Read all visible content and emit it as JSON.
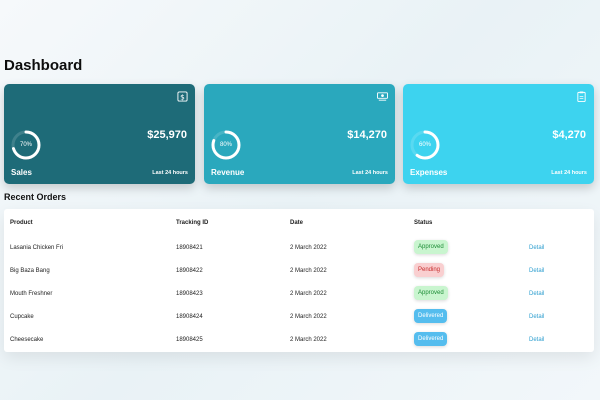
{
  "page": {
    "title": "Dashboard"
  },
  "cards": [
    {
      "label": "Sales",
      "amount": "$25,970",
      "percent_text": "70%",
      "percent": 0.7,
      "period": "Last 24 hours",
      "icon": "dollar-icon",
      "color": "#1e6b78"
    },
    {
      "label": "Revenue",
      "amount": "$14,270",
      "percent_text": "80%",
      "percent": 0.8,
      "period": "Last 24 hours",
      "icon": "money-icon",
      "color": "#2aa8bd"
    },
    {
      "label": "Expenses",
      "amount": "$4,270",
      "percent_text": "60%",
      "percent": 0.6,
      "period": "Last 24 hours",
      "icon": "clipboard-icon",
      "color": "#3dd3ef"
    }
  ],
  "orders": {
    "title": "Recent Orders",
    "headers": {
      "product": "Product",
      "tracking": "Tracking ID",
      "date": "Date",
      "status": "Status"
    },
    "rows": [
      {
        "product": "Lasania Chicken Fri",
        "tracking": "18908421",
        "date": "2 March 2022",
        "status": "Approved",
        "action": "Detail"
      },
      {
        "product": "Big Baza Bang",
        "tracking": "18908422",
        "date": "2 March 2022",
        "status": "Pending",
        "action": "Detail"
      },
      {
        "product": "Mouth Freshner",
        "tracking": "18908423",
        "date": "2 March 2022",
        "status": "Approved",
        "action": "Detail"
      },
      {
        "product": "Cupcake",
        "tracking": "18908424",
        "date": "2 March 2022",
        "status": "Delivered",
        "action": "Detail"
      },
      {
        "product": "Cheesecake",
        "tracking": "18908425",
        "date": "2 March 2022",
        "status": "Delivered",
        "action": "Detail"
      }
    ]
  },
  "status_colors": {
    "Approved": "#1c8c35",
    "Pending": "#c62b2b",
    "Delivered": "#55bdee"
  }
}
